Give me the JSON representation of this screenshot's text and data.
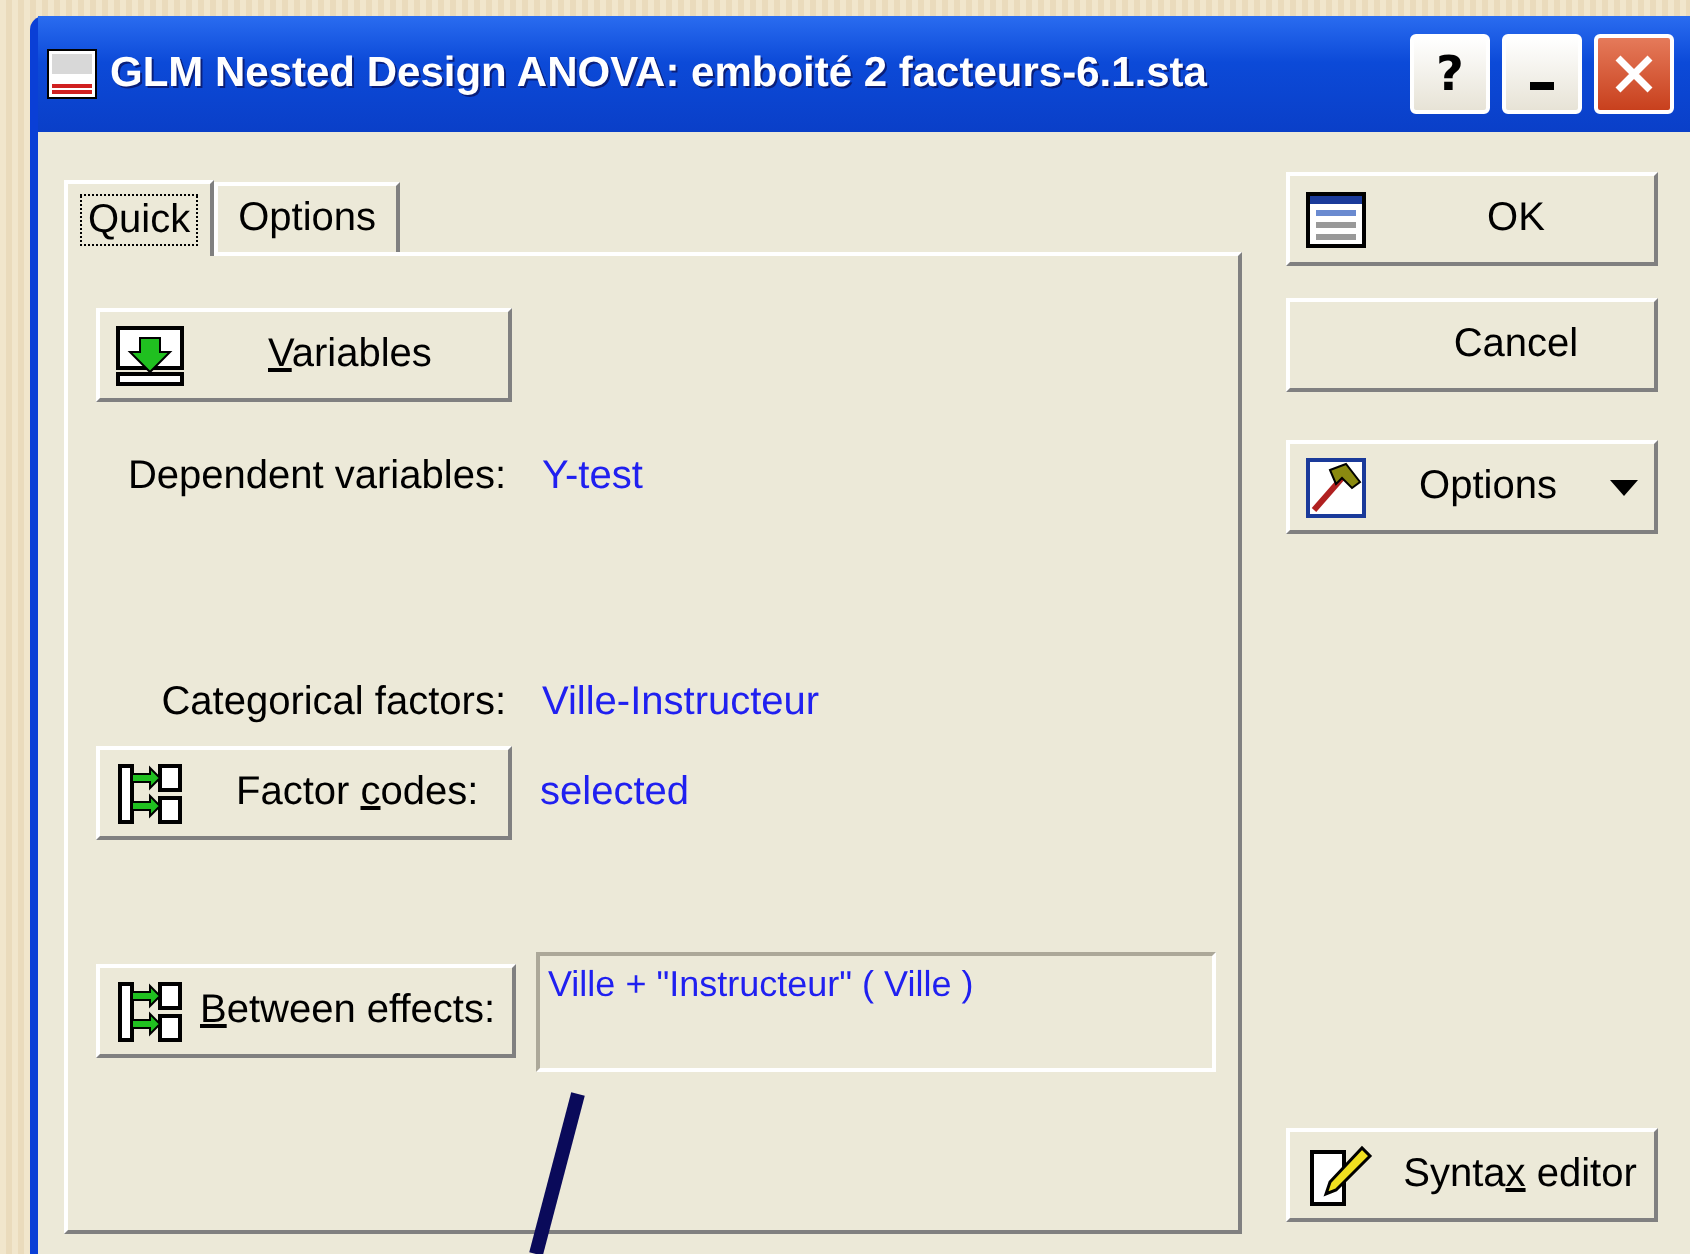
{
  "window": {
    "title": "GLM Nested Design ANOVA: emboité 2 facteurs-6.1.sta",
    "controls": [
      {
        "kind": "help",
        "label": "?"
      },
      {
        "kind": "minimize"
      },
      {
        "kind": "close"
      }
    ]
  },
  "tabs": [
    {
      "label": "Quick",
      "selected": true
    },
    {
      "label": "Options",
      "selected": false
    }
  ],
  "variables_button": {
    "key": "V",
    "after": "ariables"
  },
  "fields": [
    {
      "label": "Dependent variables:",
      "value": "Y-test"
    },
    {
      "label": "Categorical factors:",
      "value": "Ville-Instructeur"
    }
  ],
  "factor_codes": {
    "button": {
      "before": "Factor ",
      "key": "c",
      "after": "odes:"
    },
    "value": "selected"
  },
  "between_effects": {
    "button": {
      "key": "B",
      "after": "etween effects:"
    },
    "value": "Ville + \"Instructeur\" ( Ville )"
  },
  "side_buttons": [
    {
      "kind": "ok",
      "label": "OK"
    },
    {
      "kind": "cancel",
      "label": "Cancel"
    },
    {
      "kind": "options",
      "label": "Options"
    }
  ],
  "syntax_button": {
    "before": "Synta",
    "key": "x",
    "after": " editor"
  }
}
